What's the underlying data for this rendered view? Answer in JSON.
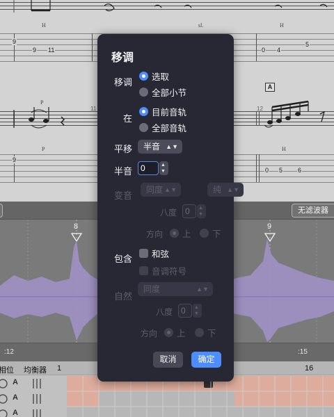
{
  "score": {
    "tab_row1": {
      "left": [
        "9",
        "9",
        "11"
      ],
      "right": [
        "0",
        "4",
        "5"
      ]
    },
    "tab_row2": {
      "left": [
        "9"
      ],
      "right": [
        "0",
        "5",
        "6"
      ]
    },
    "h_marks": [
      "H",
      "H",
      "H",
      "H",
      "H",
      "H"
    ],
    "p_marks": [
      "P",
      "P",
      "P"
    ],
    "sl_mark": "sl.",
    "bar_numbers": [
      "11",
      "12"
    ],
    "section_marker": "A"
  },
  "audio": {
    "filter_button": "无滤波器",
    "markers": [
      "8",
      "9"
    ],
    "timecodes": [
      ":12",
      ":15"
    ]
  },
  "tracks": {
    "header_labels": [
      "相位",
      "均衡器",
      "1",
      "16"
    ],
    "row_letters": [
      "A",
      "A",
      "A"
    ]
  },
  "dialog": {
    "title": "移调",
    "transpose": {
      "label": "移调",
      "options": [
        "选取",
        "全部小节"
      ],
      "selected": "选取"
    },
    "in": {
      "label": "在",
      "options": [
        "目前音轨",
        "全部音轨"
      ],
      "selected": "目前音轨"
    },
    "shift": {
      "label": "平移",
      "value": "半音"
    },
    "semitone": {
      "label": "半音",
      "value": "0"
    },
    "change": {
      "label": "变音",
      "select1": "同度",
      "select2": "纯",
      "octave_label": "八度",
      "octave_value": "0",
      "direction_label": "方向",
      "directions": [
        "上",
        "下"
      ]
    },
    "include": {
      "label": "包含",
      "chord": "和弦",
      "note_symbols": "音调符号"
    },
    "natural": {
      "label": "自然",
      "select": "同度",
      "octave_label": "八度",
      "octave_value": "0",
      "direction_label": "方向",
      "directions": [
        "上",
        "下"
      ]
    },
    "buttons": {
      "cancel": "取消",
      "ok": "确定"
    }
  }
}
